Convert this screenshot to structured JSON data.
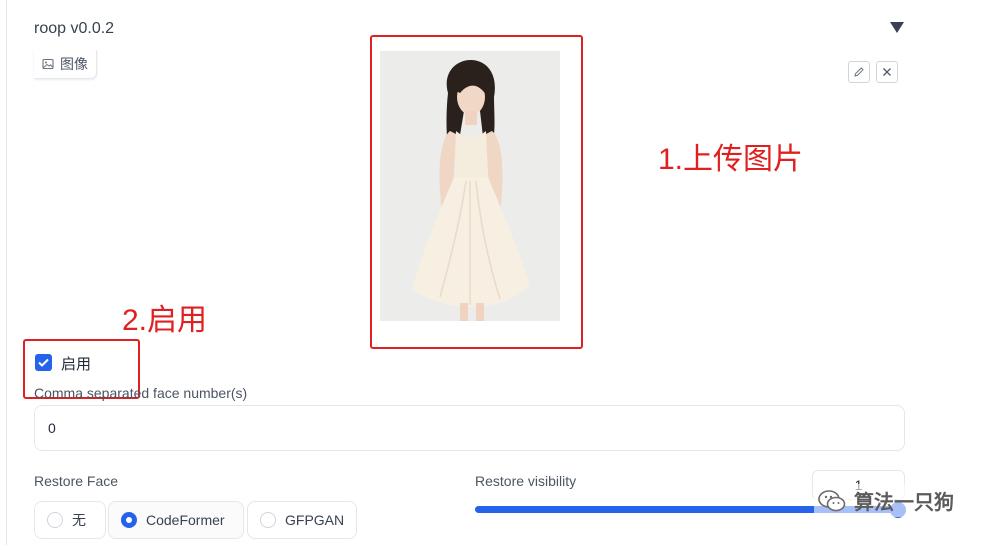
{
  "panel": {
    "title": "roop v0.0.2"
  },
  "image_tab": {
    "label": "图像"
  },
  "annotations": {
    "step1": "1.上传图片",
    "step2": "2.启用"
  },
  "enable": {
    "label": "启用",
    "checked": true
  },
  "face_numbers": {
    "label": "Comma separated face number(s)",
    "value": "0"
  },
  "restore_face": {
    "label": "Restore Face",
    "options": [
      "无",
      "CodeFormer",
      "GFPGAN"
    ],
    "selected": "CodeFormer"
  },
  "restore_visibility": {
    "label": "Restore visibility",
    "value": "1",
    "fraction": 1.0
  },
  "watermark": {
    "text": "算法一只狗"
  },
  "colors": {
    "accent": "#2563eb",
    "annotation": "#e02020"
  },
  "icons": [
    "collapse-caret-icon",
    "image-icon",
    "edit-icon",
    "close-icon",
    "checkmark-icon",
    "wechat-icon"
  ]
}
